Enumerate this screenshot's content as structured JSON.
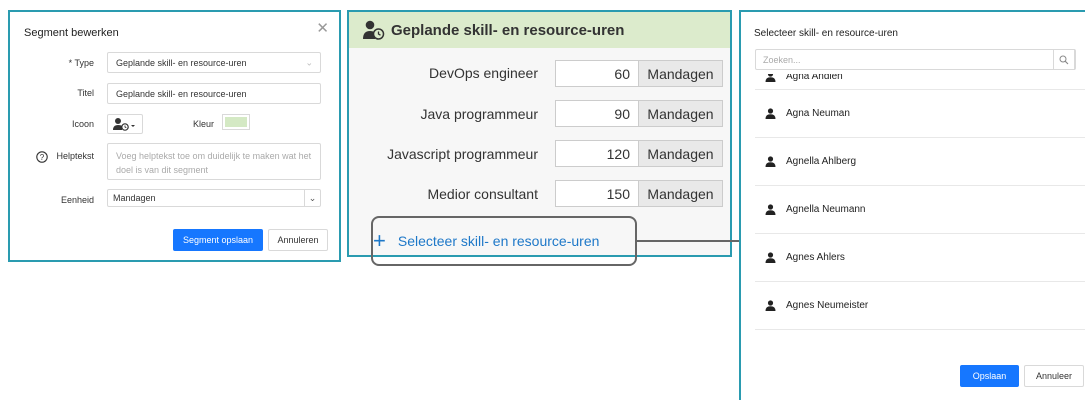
{
  "segment_dialog": {
    "title": "Segment bewerken",
    "type_label": "* Type",
    "type_value": "Geplande skill- en resource-uren",
    "titel_label": "Titel",
    "titel_value": "Geplande skill- en resource-uren",
    "icoon_label": "Icoon",
    "kleur_label": "Kleur",
    "kleur_color": "#d4e9c4",
    "helptekst_label": "Helptekst",
    "helptekst_placeholder": "Voeg helptekst toe om duidelijk te maken wat het doel is van dit segment",
    "eenheid_label": "Eenheid",
    "eenheid_value": "Mandagen",
    "save_label": "Segment opslaan",
    "cancel_label": "Annuleren"
  },
  "segment_panel": {
    "title": "Geplande skill- en resource-uren",
    "header_color": "#dcebcc",
    "rows": [
      {
        "label": "DevOps engineer",
        "value": "60",
        "unit": "Mandagen"
      },
      {
        "label": "Java programmeur",
        "value": "90",
        "unit": "Mandagen"
      },
      {
        "label": "Javascript programmeur",
        "value": "120",
        "unit": "Mandagen"
      },
      {
        "label": "Medior consultant",
        "value": "150",
        "unit": "Mandagen"
      }
    ],
    "add_label": "Selecteer skill- en resource-uren"
  },
  "select_panel": {
    "title": "Selecteer skill- en resource-uren",
    "search_placeholder": "Zoeken...",
    "people": [
      "Agna Andien",
      "Agna Neuman",
      "Agnella Ahlberg",
      "Agnella Neumann",
      "Agnes Ahlers",
      "Agnes Neumeister"
    ],
    "save_label": "Opslaan",
    "cancel_label": "Annuleer"
  }
}
